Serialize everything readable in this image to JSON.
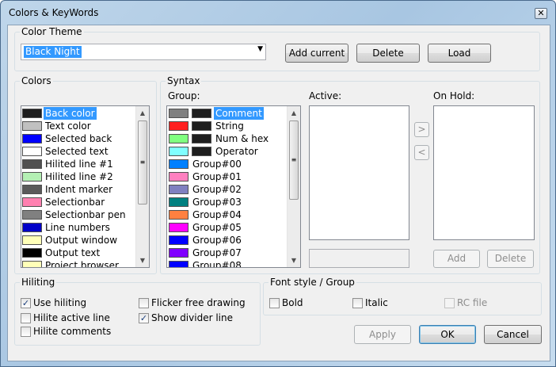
{
  "window": {
    "title": "Colors & KeyWords",
    "close_glyph": "✕"
  },
  "color_theme": {
    "label": "Color Theme",
    "selected": "Black Night",
    "add_current": "Add current",
    "delete": "Delete",
    "load": "Load"
  },
  "colors": {
    "label": "Colors",
    "items": [
      {
        "label": "Back color",
        "color": "#1e1e1e"
      },
      {
        "label": "Text color",
        "color": "#c0c0c0"
      },
      {
        "label": "Selected back",
        "color": "#0000ff"
      },
      {
        "label": "Selected text",
        "color": "#ffffff"
      },
      {
        "label": "Hilited line #1",
        "color": "#505050"
      },
      {
        "label": "Hilited line #2",
        "color": "#b4f0b4"
      },
      {
        "label": "Indent marker",
        "color": "#5a5a5a"
      },
      {
        "label": "Selectionbar",
        "color": "#ff80b0"
      },
      {
        "label": "Selectionbar pen",
        "color": "#808080"
      },
      {
        "label": "Line numbers",
        "color": "#0000c8"
      },
      {
        "label": "Output window",
        "color": "#ffffb8"
      },
      {
        "label": "Output text",
        "color": "#000000"
      },
      {
        "label": "Project browser",
        "color": "#ffffb8"
      }
    ]
  },
  "syntax": {
    "label": "Syntax",
    "group_label": "Group:",
    "active_label": "Active:",
    "on_hold_label": "On Hold:",
    "groups": [
      {
        "label": "Comment",
        "fg": "#808080",
        "bg": "#1e1e1e"
      },
      {
        "label": "String",
        "fg": "#ff2020",
        "bg": "#1e1e1e"
      },
      {
        "label": "Num & hex",
        "fg": "#80ff80",
        "bg": "#1e1e1e"
      },
      {
        "label": "Operator",
        "fg": "#80ffff",
        "bg": "#1e1e1e"
      },
      {
        "label": "Group#00",
        "fg": "#0080ff"
      },
      {
        "label": "Group#01",
        "fg": "#ff80c0"
      },
      {
        "label": "Group#02",
        "fg": "#8080c0"
      },
      {
        "label": "Group#03",
        "fg": "#008080"
      },
      {
        "label": "Group#04",
        "fg": "#ff8040"
      },
      {
        "label": "Group#05",
        "fg": "#ff00ff"
      },
      {
        "label": "Group#06",
        "fg": "#0000ff"
      },
      {
        "label": "Group#07",
        "fg": "#8000ff"
      },
      {
        "label": "Group#08",
        "fg": "#0000ff"
      }
    ],
    "move_right": ">",
    "move_left": "<",
    "add": "Add",
    "delete": "Delete"
  },
  "hiliting": {
    "label": "Hiliting",
    "options": [
      {
        "label": "Use hiliting",
        "checked": true
      },
      {
        "label": "Hilite active line",
        "checked": false
      },
      {
        "label": "Hilite comments",
        "checked": false
      },
      {
        "label": "Flicker free drawing",
        "checked": false
      },
      {
        "label": "Show divider line",
        "checked": true
      }
    ]
  },
  "font_style": {
    "label": "Font style / Group",
    "options": [
      {
        "label": "Bold",
        "checked": false
      },
      {
        "label": "Italic",
        "checked": false
      },
      {
        "label": "RC file",
        "checked": false
      }
    ]
  },
  "footer": {
    "apply": "Apply",
    "ok": "OK",
    "cancel": "Cancel"
  },
  "glyphs": {
    "check": "✓",
    "arrow_up": "▲",
    "arrow_down": "▼",
    "combo_arrow": "▼",
    "grip": "≡"
  }
}
